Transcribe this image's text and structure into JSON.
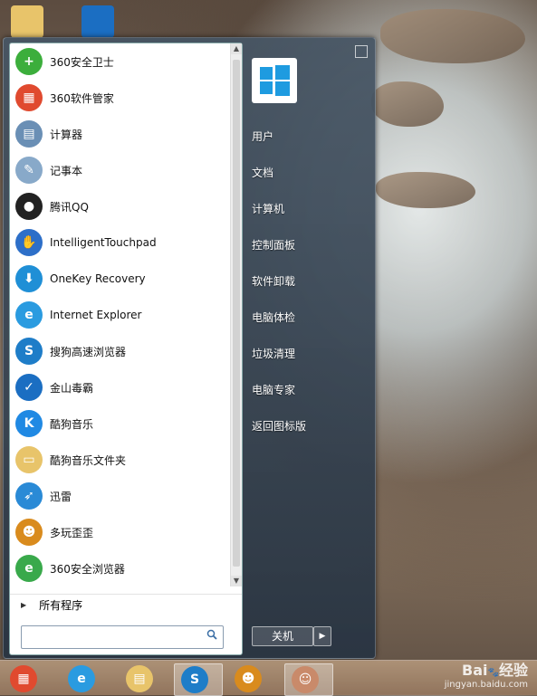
{
  "start_menu": {
    "apps": [
      {
        "label": "360安全卫士",
        "icon": "360-safe-guard-icon",
        "color": "#3cae3c",
        "glyph": "+"
      },
      {
        "label": "360软件管家",
        "icon": "360-software-manager-icon",
        "color": "#e04a2f",
        "glyph": "▦"
      },
      {
        "label": "计算器",
        "icon": "calculator-icon",
        "color": "#6a8fb5",
        "glyph": "▤"
      },
      {
        "label": "记事本",
        "icon": "notepad-icon",
        "color": "#88a9c9",
        "glyph": "✎"
      },
      {
        "label": "腾讯QQ",
        "icon": "qq-penguin-icon",
        "color": "#222222",
        "glyph": "●"
      },
      {
        "label": "IntelligentTouchpad",
        "icon": "touchpad-hand-icon",
        "color": "#2d6fc8",
        "glyph": "✋"
      },
      {
        "label": "OneKey Recovery",
        "icon": "onekey-recovery-icon",
        "color": "#1f8fd6",
        "glyph": "⬇"
      },
      {
        "label": "Internet Explorer",
        "icon": "internet-explorer-icon",
        "color": "#2a9be0",
        "glyph": "e"
      },
      {
        "label": "搜狗高速浏览器",
        "icon": "sogou-browser-icon",
        "color": "#1e7dc8",
        "glyph": "S"
      },
      {
        "label": "金山毒霸",
        "icon": "kingsoft-antivirus-icon",
        "color": "#1b6ec2",
        "glyph": "✓"
      },
      {
        "label": "酷狗音乐",
        "icon": "kugou-music-icon",
        "color": "#2089e3",
        "glyph": "K"
      },
      {
        "label": "酷狗音乐文件夹",
        "icon": "folder-icon",
        "color": "#e8c46a",
        "glyph": "▭"
      },
      {
        "label": "迅雷",
        "icon": "xunlei-bird-icon",
        "color": "#2a8ad6",
        "glyph": "➶"
      },
      {
        "label": "多玩歪歪",
        "icon": "yy-raccoon-icon",
        "color": "#d98b1d",
        "glyph": "☻"
      },
      {
        "label": "360安全浏览器",
        "icon": "360-browser-icon",
        "color": "#39a94b",
        "glyph": "e"
      }
    ],
    "all_programs": "所有程序",
    "search_placeholder": "",
    "right_menu": [
      "用户",
      "文档",
      "计算机",
      "控制面板",
      "软件卸载",
      "电脑体检",
      "垃圾清理",
      "电脑专家",
      "返回图标版"
    ],
    "shutdown_label": "关机"
  },
  "taskbar": {
    "items": [
      {
        "icon": "360-software-manager-icon",
        "color": "#e04a2f",
        "glyph": "▦"
      },
      {
        "icon": "internet-explorer-icon",
        "color": "#2a9be0",
        "glyph": "e"
      },
      {
        "icon": "file-explorer-icon",
        "color": "#e8c46a",
        "glyph": "▤"
      },
      {
        "icon": "sogou-browser-icon",
        "color": "#1e7dc8",
        "glyph": "S"
      },
      {
        "icon": "yy-raccoon-icon",
        "color": "#d98b1d",
        "glyph": "☻"
      },
      {
        "icon": "users-icon",
        "color": "#c98a6a",
        "glyph": "☺"
      }
    ]
  },
  "watermark": {
    "line1": "Bai",
    "line2": "经验",
    "line3": "jingyan.baidu.com"
  }
}
